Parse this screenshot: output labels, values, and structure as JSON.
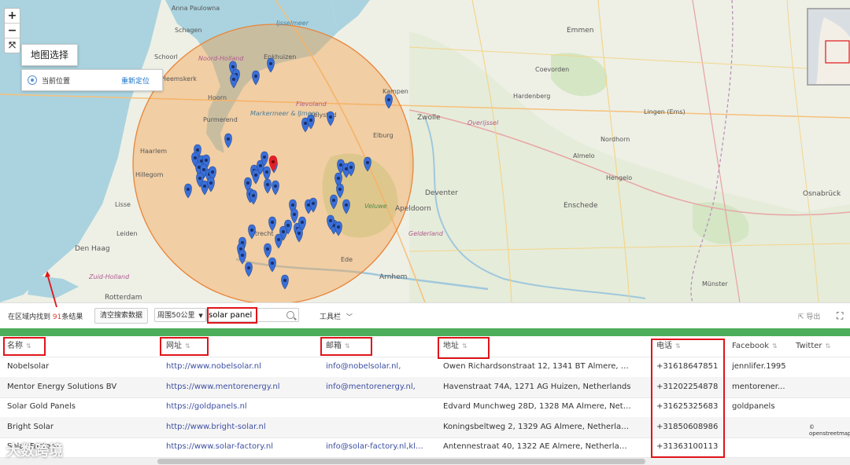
{
  "map": {
    "zoom_in": "+",
    "zoom_out": "−",
    "fit": "⤧",
    "map_select_label": "地图选择",
    "current_location_label": "当前位置",
    "relocate_label": "重新定位",
    "osm_credit": "© openstreetmap",
    "labels": [
      {
        "text": "Anna Paulowna"
      },
      {
        "text": "Schagen"
      },
      {
        "text": "Schoorl"
      },
      {
        "text": "Heemskerk"
      },
      {
        "text": "Noord-Holland"
      },
      {
        "text": "Purmerend"
      },
      {
        "text": "Haarlem"
      },
      {
        "text": "Hillegom"
      },
      {
        "text": "Lisse"
      },
      {
        "text": "Leiden"
      },
      {
        "text": "Den Haag"
      },
      {
        "text": "Zuid-Holland"
      },
      {
        "text": "Rotterdam"
      },
      {
        "text": "Markermeer & IJmeer"
      },
      {
        "text": "Flevoland"
      },
      {
        "text": "Lelystad"
      },
      {
        "text": "Elburg"
      },
      {
        "text": "Zwolle"
      },
      {
        "text": "Deventer"
      },
      {
        "text": "Apeldoorn"
      },
      {
        "text": "Arnhem"
      },
      {
        "text": "Ede"
      },
      {
        "text": "Gelderland"
      },
      {
        "text": "Veluwe"
      },
      {
        "text": "Emmen"
      },
      {
        "text": "Coevorden"
      },
      {
        "text": "Hardenberg"
      },
      {
        "text": "Almelo"
      },
      {
        "text": "Hengelo"
      },
      {
        "text": "Enschede"
      },
      {
        "text": "Nordhorn"
      },
      {
        "text": "Lingen (Ems)"
      },
      {
        "text": "Osnabrück"
      },
      {
        "text": "Münster"
      },
      {
        "text": "Ijsselmeer"
      },
      {
        "text": "Kampen"
      },
      {
        "text": "Overijssel"
      },
      {
        "text": "Utrecht"
      },
      {
        "text": "Hoorn"
      },
      {
        "text": "Enkhuizen"
      }
    ]
  },
  "toolbar": {
    "found_prefix": "在区域内找到 ",
    "found_count": "91",
    "found_suffix": "条结果",
    "clear_label": "清空搜索数据",
    "range_label": "周围50公里",
    "search_value": "solar panel",
    "tools_label": "工具栏",
    "export_label": "导出"
  },
  "table": {
    "columns": [
      "名称",
      "网址",
      "邮箱",
      "地址",
      "电话",
      "Facebook",
      "Twitter"
    ],
    "rows": [
      [
        "Nobelsolar",
        "http://www.nobelsolar.nl",
        "info@nobelsolar.nl,",
        "Owen Richardsonstraat 12, 1341 BT Almere, Netherla...",
        "+31618647851",
        "jennlifer.1995",
        ""
      ],
      [
        "Mentor Energy Solutions BV",
        "https://www.mentorenergy.nl",
        "info@mentorenergy.nl,",
        "Havenstraat 74A, 1271 AG Huizen, Netherlands",
        "+31202254878",
        "mentorener...",
        ""
      ],
      [
        "Solar Gold Panels",
        "https://goldpanels.nl",
        "",
        "Edvard Munchweg 28D, 1328 MA Almere, Netherlands",
        "+31625325683",
        "goldpanels",
        ""
      ],
      [
        "Bright Solar",
        "http://www.bright-solar.nl",
        "",
        "Koningsbeltweg 2, 1329 AG Almere, Netherlands",
        "+31850608986",
        "",
        ""
      ],
      [
        "Solar Factory",
        "https://www.solar-factory.nl",
        "info@solar-factory.nl,klant...",
        "Antennestraat 40, 1322 AE Almere, Netherlands",
        "+31363100113",
        "",
        ""
      ]
    ]
  },
  "watermark": "大数跨境",
  "colors": {
    "accent": "#1a73c8",
    "green_bar": "#4cae5a",
    "highlight": "#e0141a",
    "marker": "#3a6fd8",
    "marker_selected": "#e0202a",
    "radius_fill": "#f5a04a"
  }
}
